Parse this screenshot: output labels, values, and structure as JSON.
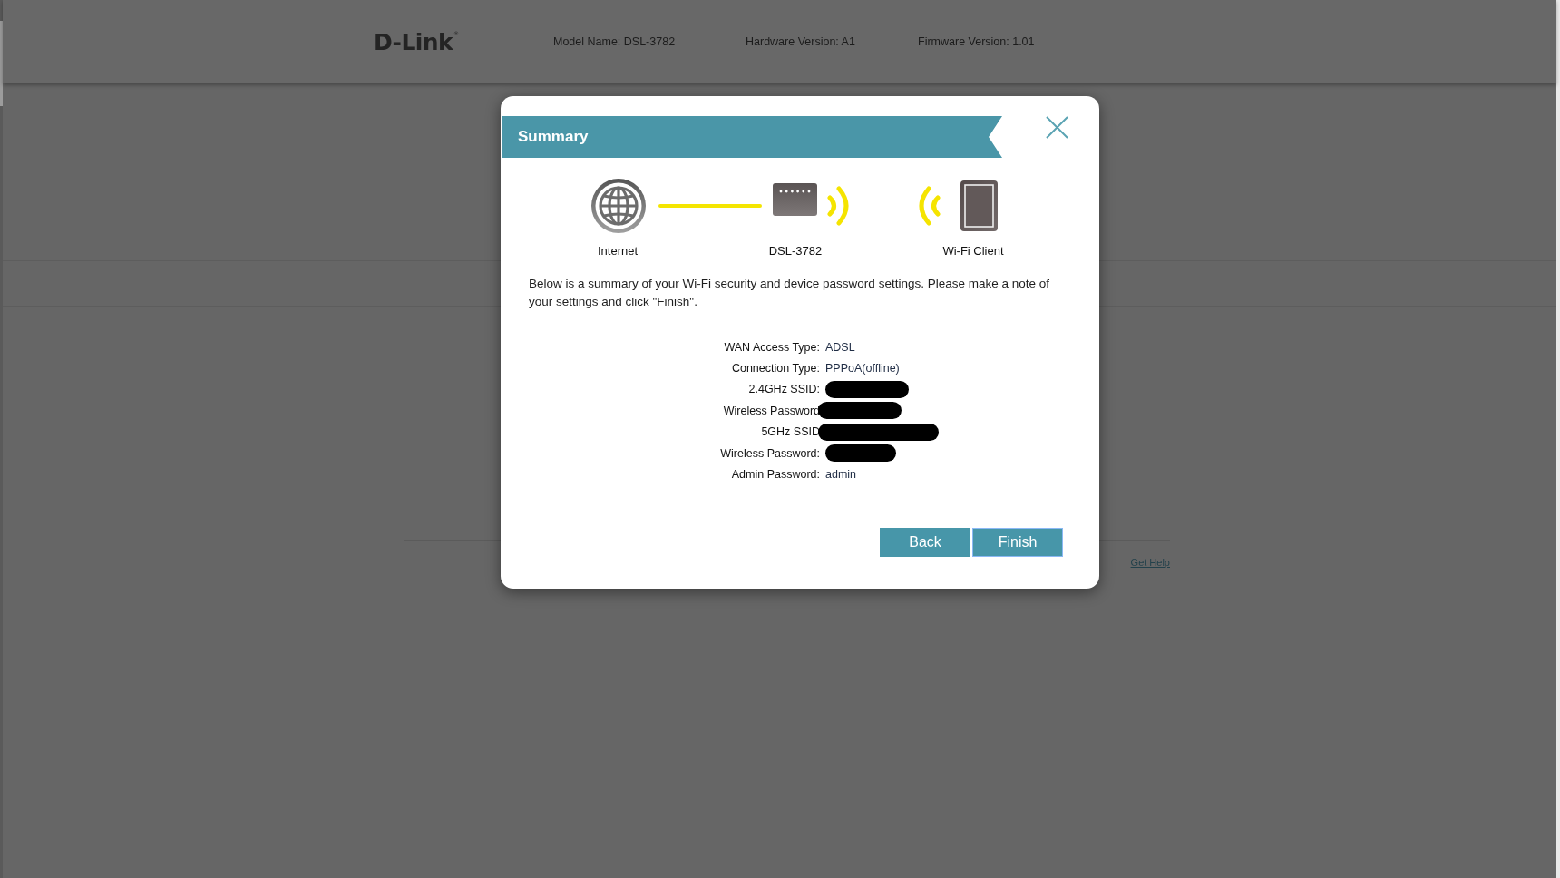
{
  "header": {
    "logo": {
      "text": "D-Link",
      "mark": "®"
    },
    "info": [
      "Model Name: DSL-3782",
      "Hardware Version: A1",
      "Firmware Version: 1.01"
    ]
  },
  "dialog": {
    "title": "Summary",
    "diagram": [
      {
        "kind": "internet",
        "label": "Internet"
      },
      {
        "kind": "router",
        "label": "DSL-3782"
      },
      {
        "kind": "client",
        "label": "Wi-Fi Client"
      }
    ],
    "intro": "Below is a summary of your Wi-Fi security and device password settings. Please make a note of your settings and click \"Finish\".",
    "settings": [
      {
        "label": "WAN Access Type:",
        "value": "ADSL",
        "redacted": false
      },
      {
        "label": "Connection Type:",
        "value": "PPPoA(offline)",
        "redacted": false
      },
      {
        "label": "2.4GHz SSID:",
        "redacted": true
      },
      {
        "label": "Wireless Password",
        "redacted": true
      },
      {
        "label": "5GHz SSID",
        "redacted": true
      },
      {
        "label": "Wireless Password:",
        "redacted": true
      },
      {
        "label": "Admin Password:",
        "value": "admin",
        "redacted": false
      }
    ],
    "buttons": [
      {
        "label": "Back",
        "focused": false
      },
      {
        "label": "Finish",
        "focused": true
      }
    ]
  },
  "footer": {
    "help_link": "Get Help"
  }
}
